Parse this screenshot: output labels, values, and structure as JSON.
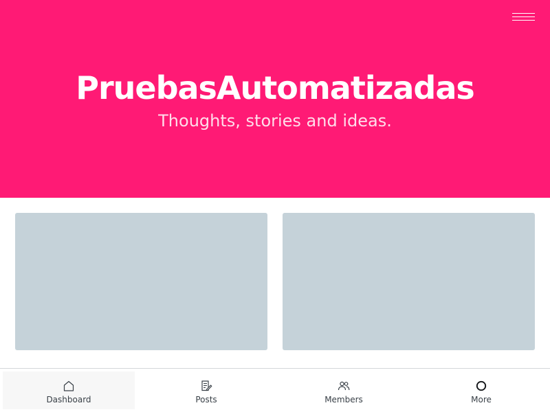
{
  "header": {
    "title": "PruebasAutomatizadas",
    "description": "Thoughts, stories and ideas.",
    "accent_color": "#ff1a75",
    "menu_icon": "hamburger-menu-icon"
  },
  "cards": [
    {
      "placeholder_color": "#c5d2d9"
    },
    {
      "placeholder_color": "#c5d2d9"
    }
  ],
  "bottom_nav": {
    "items": [
      {
        "label": "Dashboard",
        "icon": "home-icon",
        "active": true
      },
      {
        "label": "Posts",
        "icon": "posts-icon",
        "active": false
      },
      {
        "label": "Members",
        "icon": "members-icon",
        "active": false
      },
      {
        "label": "More",
        "icon": "circle-icon",
        "active": false
      }
    ]
  }
}
